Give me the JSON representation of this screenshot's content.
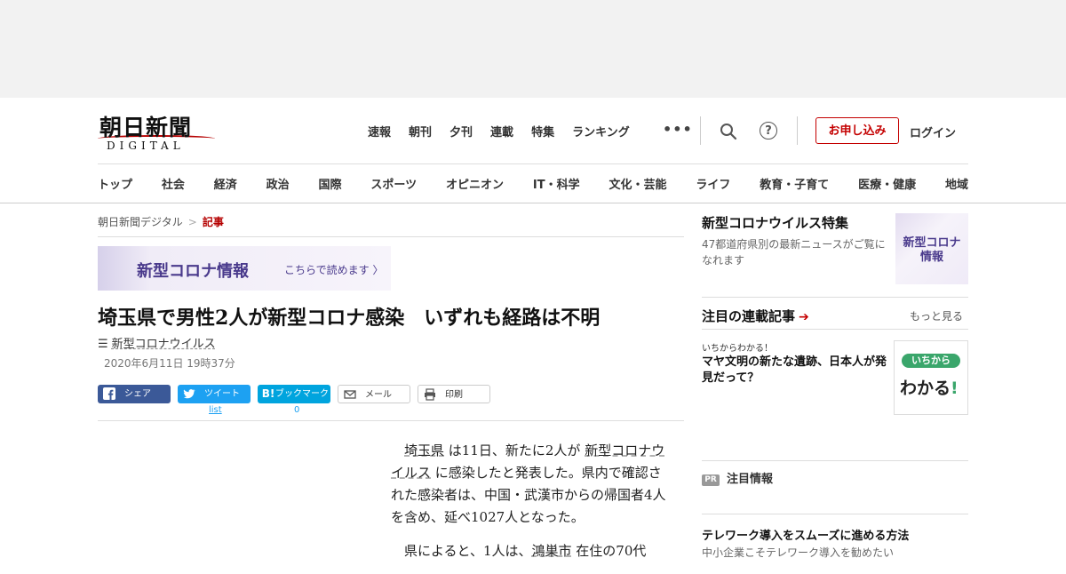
{
  "header": {
    "logo_main": "朝日新聞",
    "logo_sub": "DIGITAL",
    "top_nav": [
      "速報",
      "朝刊",
      "夕刊",
      "連載",
      "特集",
      "ランキング"
    ],
    "more": "•••",
    "help": "?",
    "apply_button": "お申し込み",
    "login": "ログイン"
  },
  "category_nav": [
    "トップ",
    "社会",
    "経済",
    "政治",
    "国際",
    "スポーツ",
    "オピニオン",
    "IT・科学",
    "文化・芸能",
    "ライフ",
    "教育・子育て",
    "医療・健康",
    "地域"
  ],
  "breadcrumb": {
    "home": "朝日新聞デジタル",
    "separator": ">",
    "current": "記事"
  },
  "banner": {
    "title": "新型コロナ情報",
    "link": "こちらで読めます",
    "chevron": "〉"
  },
  "article": {
    "headline": "埼玉県で男性2人が新型コロナ感染　いずれも経路は不明",
    "tag_icon": "☰",
    "tag": "新型コロナウイルス",
    "date": "2020年6月11日 19時37分",
    "body": [
      {
        "link1": "埼玉県",
        "text1": " は11日、新たに2人が ",
        "link2": "新型コロナウイルス",
        "text2": " に感染したと発表した。県内で確認された感染者は、中国・武漢市からの帰国者4人を含め、延べ1027人となった。"
      },
      {
        "text1": "県によると、1人は、",
        "link1": "鴻巣市",
        "text2": " 在住の70代"
      }
    ]
  },
  "share": {
    "facebook": "シェア",
    "twitter": "ツイート",
    "twitter_count": "list",
    "hatena": "ブックマーク",
    "hatena_icon": "B!",
    "hatena_count": "0",
    "mail": "メール",
    "print": "印刷"
  },
  "sidebar": {
    "feature": {
      "title": "新型コロナウイルス特集",
      "desc": "47都道府県別の最新ニュースがご覧になれます",
      "thumb_text": "新型コロナ情報"
    },
    "serial": {
      "title": "注目の連載記事",
      "arrow": "➔",
      "more": "もっと見る",
      "kicker": "いちからわかる！",
      "headline": "マヤ文明の新たな遺跡、日本人が発見だって？",
      "thumb_top": "いちから",
      "thumb_main": "わかる",
      "thumb_mark": "!"
    },
    "pr": {
      "badge": "PR",
      "label": "注目情報",
      "headline": "テレワーク導入をスムーズに進める方法",
      "sub": "中小企業こそテレワーク導入を勧めたい"
    }
  },
  "colors": {
    "brand_red": "#c40000",
    "facebook": "#3b5998",
    "twitter": "#1da1f2",
    "hatena": "#00a4de",
    "corona_purple": "#4a3a8c"
  }
}
